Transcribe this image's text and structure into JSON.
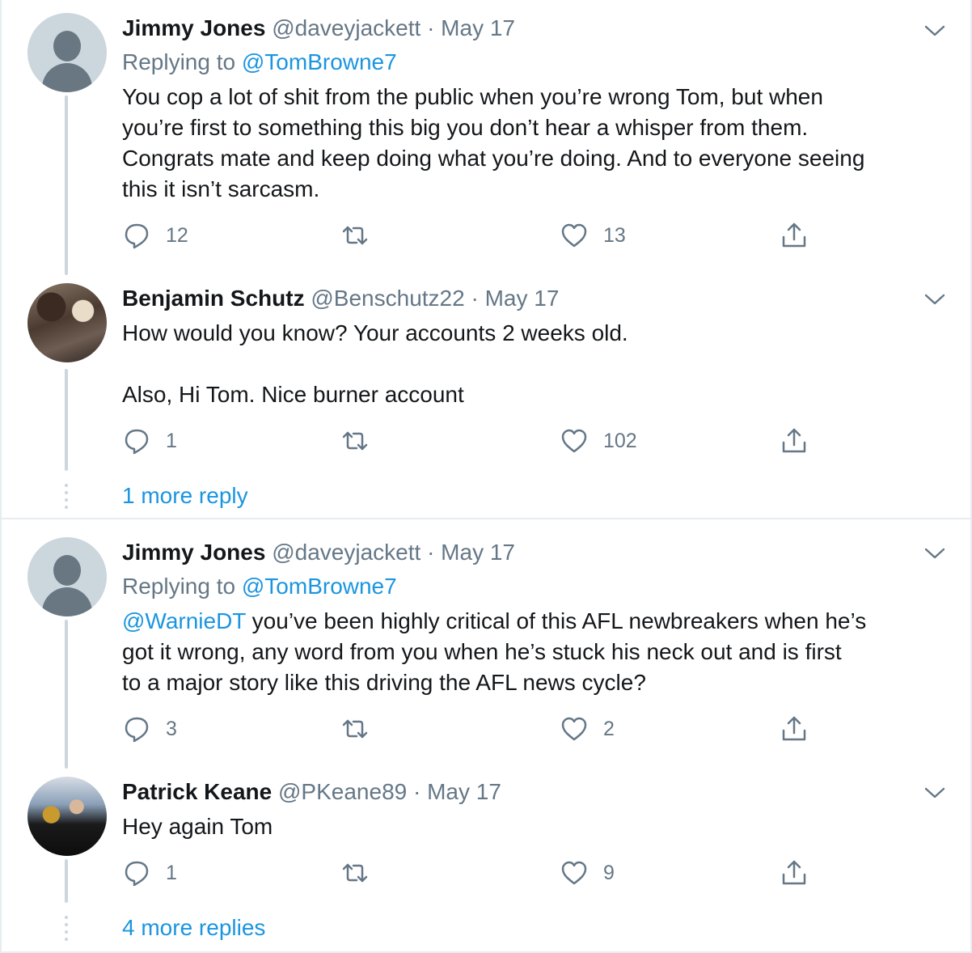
{
  "tweets": [
    {
      "name": "Jimmy Jones",
      "handle": "@daveyjackett",
      "sep": "·",
      "date": "May 17",
      "replying_prefix": "Replying to",
      "replying_to": "@TomBrowne7",
      "lines": [
        "You cop a lot of shit from the public when you’re wrong Tom, but when",
        "you’re first to something this big you don’t hear a whisper from them.",
        "Congrats mate and keep doing what you’re doing. And to everyone seeing",
        "this it isn’t sarcasm."
      ],
      "reply_count": "12",
      "retweet_count": "",
      "like_count": "13",
      "avatar_icon": "default-profile-avatar"
    },
    {
      "name": "Benjamin Schutz",
      "handle": "@Benschutz22",
      "sep": "·",
      "date": "May 17",
      "lines": [
        "How would you know? Your accounts 2 weeks old.",
        "",
        "Also, Hi Tom. Nice burner account"
      ],
      "reply_count": "1",
      "retweet_count": "",
      "like_count": "102",
      "avatar_icon": "user-photo-avatar"
    },
    {
      "name": "Jimmy Jones",
      "handle": "@daveyjackett",
      "sep": "·",
      "date": "May 17",
      "replying_prefix": "Replying to",
      "replying_to": "@TomBrowne7",
      "mention": "@WarnieDT",
      "lines": [
        " you’ve been highly critical of this AFL newbreakers when he’s",
        "got it wrong, any word from you when he’s stuck his neck out and is first",
        "to a major story like this driving the AFL news cycle?"
      ],
      "reply_count": "3",
      "retweet_count": "",
      "like_count": "2",
      "avatar_icon": "default-profile-avatar"
    },
    {
      "name": "Patrick Keane",
      "handle": "@PKeane89",
      "sep": "·",
      "date": "May 17",
      "lines": [
        "Hey again Tom"
      ],
      "reply_count": "1",
      "retweet_count": "",
      "like_count": "9",
      "avatar_icon": "user-photo-avatar"
    }
  ],
  "more_replies": [
    "1 more reply",
    "4 more replies"
  ],
  "colors": {
    "text": "#14171a",
    "secondary": "#657786",
    "link": "#1b95e0",
    "divider": "#e6ecf0",
    "thread_line": "#ccd6dd"
  }
}
